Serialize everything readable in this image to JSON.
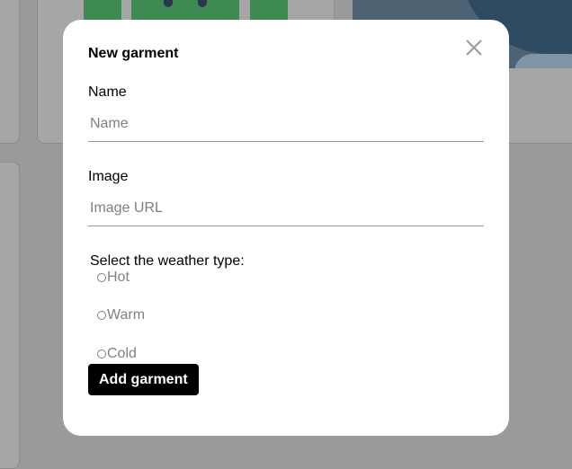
{
  "modal": {
    "title": "New garment",
    "name_label": "Name",
    "name_placeholder": "Name",
    "name_value": "",
    "image_label": "Image",
    "image_placeholder": "Image URL",
    "image_value": "",
    "weather_prompt": "Select the weather type:",
    "weather_options": [
      "Hot",
      "Warm",
      "Cold"
    ],
    "selected_weather": null,
    "submit_label": "Add garment"
  },
  "icons": {
    "close": "close-icon",
    "radio": "radio-empty-icon"
  },
  "colors": {
    "overlay": "#9a9a9a",
    "modal_bg": "#ffffff",
    "button_bg": "#000000",
    "button_text": "#ffffff",
    "placeholder": "#808080"
  }
}
